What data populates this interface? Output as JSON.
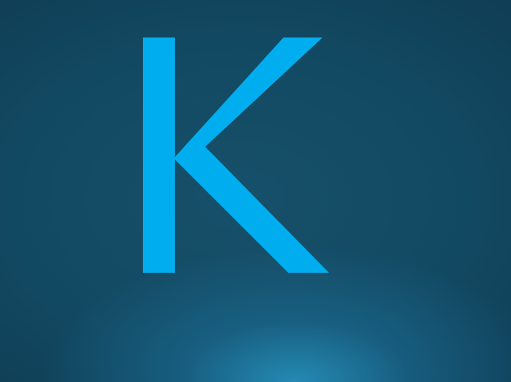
{
  "display": {
    "glyph": "K",
    "glyph_color": "#00aeef",
    "background_colors": [
      "#0f3c53",
      "#17506a",
      "#2a92bf"
    ]
  }
}
